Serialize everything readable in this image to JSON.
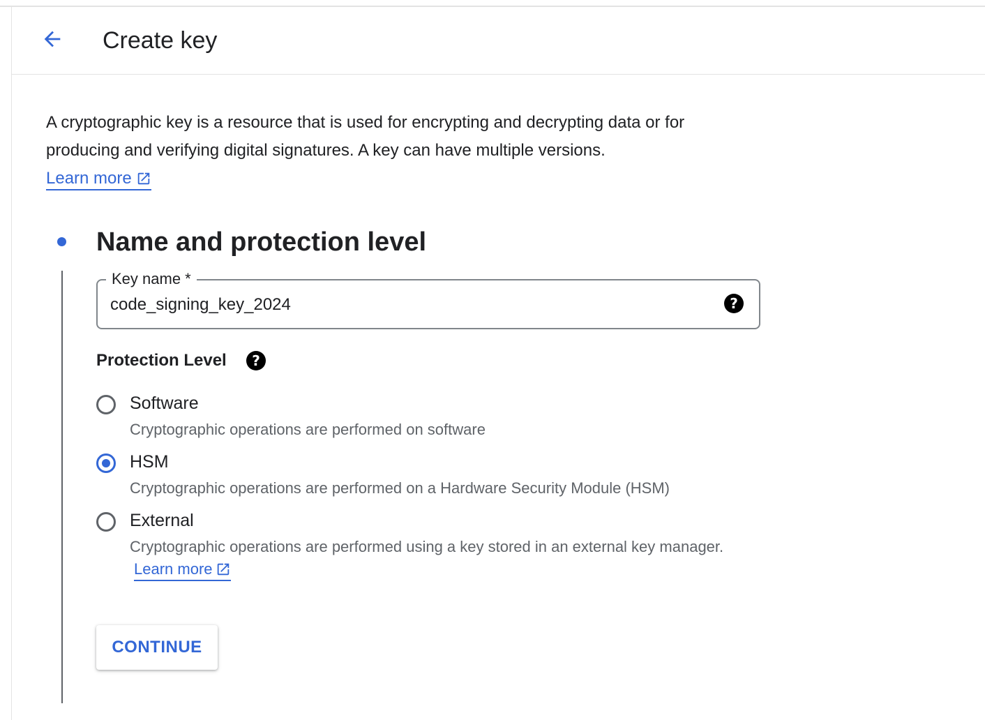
{
  "header": {
    "back_icon": "arrow-back-icon",
    "title": "Create key"
  },
  "intro": {
    "description": "A cryptographic key is a resource that is used for encrypting and decrypting data or for producing and verifying digital signatures. A key can have multiple versions.",
    "learn_more": "Learn more",
    "learn_more_icon": "open-in-new-icon"
  },
  "step": {
    "title": "Name and protection level",
    "key_name": {
      "label": "Key name *",
      "value": "code_signing_key_2024",
      "help_icon": "help-icon"
    },
    "protection_level": {
      "label": "Protection Level",
      "help_icon": "help-icon",
      "selected": "HSM",
      "options": [
        {
          "title": "Software",
          "description": "Cryptographic operations are performed on software",
          "checked": false
        },
        {
          "title": "HSM",
          "description": "Cryptographic operations are performed on a Hardware Security Module (HSM)",
          "checked": true
        },
        {
          "title": "External",
          "description": "Cryptographic operations are performed using a key stored in an external key manager.",
          "learn_more": "Learn more",
          "checked": false
        }
      ]
    },
    "continue_label": "CONTINUE"
  },
  "colors": {
    "accent": "#3367d6",
    "text": "#202124",
    "secondary_text": "#5f6368",
    "border": "#80868b"
  }
}
